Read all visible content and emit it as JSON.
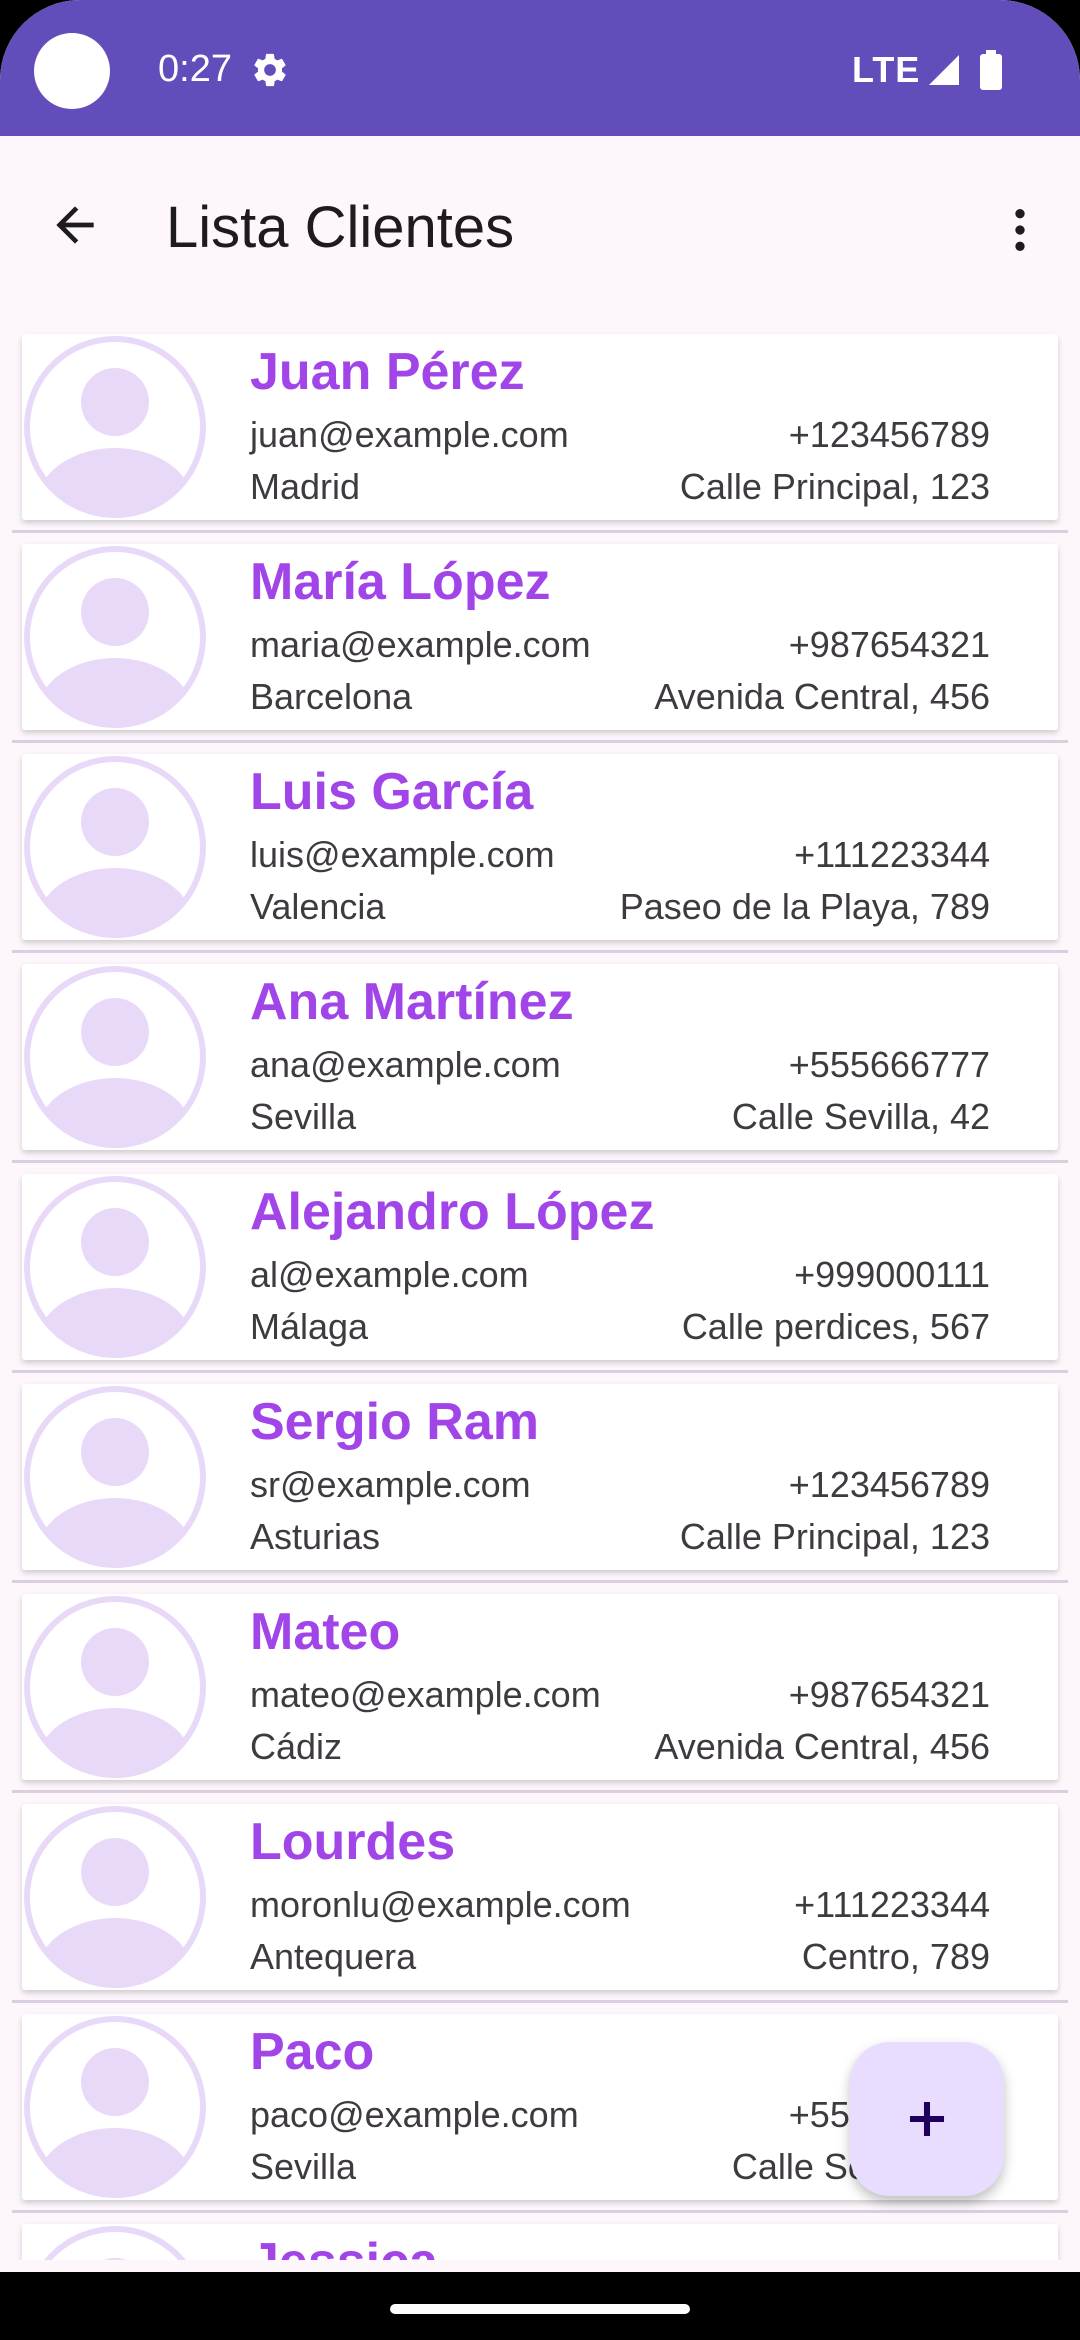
{
  "status_bar": {
    "time": "0:27",
    "network": "LTE"
  },
  "app_bar": {
    "title": "Lista Clientes"
  },
  "colors": {
    "status_bar": "#634dba",
    "name_text": "#a145e8",
    "avatar": "#e9d9f9",
    "fab_bg": "#e9ddff",
    "fab_icon": "#21005d"
  },
  "clients": [
    {
      "name": "Juan Pérez",
      "email": "juan@example.com",
      "phone": "+123456789",
      "city": "Madrid",
      "address": "Calle Principal, 123"
    },
    {
      "name": "María López",
      "email": "maria@example.com",
      "phone": "+987654321",
      "city": "Barcelona",
      "address": "Avenida Central, 456"
    },
    {
      "name": "Luis García",
      "email": "luis@example.com",
      "phone": "+111223344",
      "city": "Valencia",
      "address": "Paseo de la Playa, 789"
    },
    {
      "name": "Ana Martínez",
      "email": "ana@example.com",
      "phone": "+555666777",
      "city": "Sevilla",
      "address": "Calle Sevilla, 42"
    },
    {
      "name": "Alejandro López",
      "email": "al@example.com",
      "phone": "+999000111",
      "city": "Málaga",
      "address": "Calle perdices, 567"
    },
    {
      "name": "Sergio Ram",
      "email": "sr@example.com",
      "phone": "+123456789",
      "city": "Asturias",
      "address": "Calle Principal, 123"
    },
    {
      "name": "Mateo",
      "email": "mateo@example.com",
      "phone": "+987654321",
      "city": "Cádiz",
      "address": "Avenida Central, 456"
    },
    {
      "name": "Lourdes",
      "email": "moronlu@example.com",
      "phone": "+111223344",
      "city": "Antequera",
      "address": "Centro, 789"
    },
    {
      "name": "Paco",
      "email": "paco@example.com",
      "phone": "+555666777",
      "city": "Sevilla",
      "address": "Calle Sevilla, 42"
    },
    {
      "name": "Jessica",
      "email": "",
      "phone": "",
      "city": "",
      "address": ""
    }
  ],
  "icons": {
    "back": "arrow-back-icon",
    "menu": "more-vert-icon",
    "fab": "add-icon",
    "avatar": "account-circle-icon"
  }
}
